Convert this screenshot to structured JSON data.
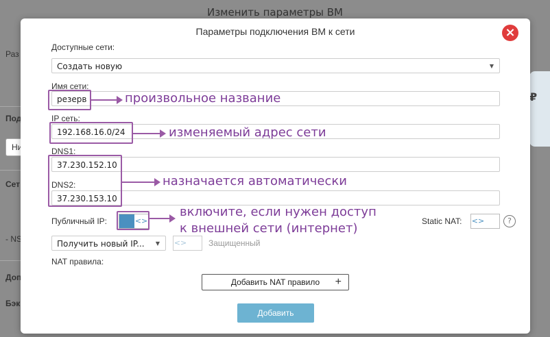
{
  "background": {
    "title": "Изменить параметры ВМ",
    "fragments": [
      "Раз",
      "Под",
      "Ни",
      "Сет",
      "- NS",
      "Доп",
      "Бэк"
    ],
    "currency": "₽"
  },
  "modal": {
    "title": "Параметры подключения ВМ к сети",
    "close_icon": "close-icon",
    "available_networks": {
      "label": "Доступные сети:",
      "value": "Создать новую"
    },
    "network_name": {
      "label": "Имя сети:",
      "value": "резерв"
    },
    "ip_network": {
      "label": "IP сеть:",
      "value": "192.168.16.0/24"
    },
    "dns1": {
      "label": "DNS1:",
      "value": "37.230.152.10"
    },
    "dns2": {
      "label": "DNS2:",
      "value": "37.230.153.10"
    },
    "public_ip": {
      "label": "Публичный IP:",
      "toggle_glyph": "<>"
    },
    "static_nat": {
      "label": "Static NAT:",
      "toggle_glyph": "<>",
      "help": "?"
    },
    "ip_select": {
      "value": "Получить новый IP..."
    },
    "protected": {
      "label": "Защищенный",
      "toggle_glyph": "<>"
    },
    "nat_rules": {
      "label": "NAT правила:"
    },
    "add_nat_button": {
      "label": "Добавить NAT правило",
      "plus": "+"
    },
    "add_button": {
      "label": "Добавить"
    }
  },
  "annotations": {
    "name": "произвольное название",
    "ip": "изменяемый адрес сети",
    "dns": "назначается автоматически",
    "public_line1": "включите, если нужен доступ",
    "public_line2": "к внешней сети (интернет)"
  },
  "colors": {
    "accent": "#9a5aa5",
    "annotation_text": "#7d3c98",
    "close": "#e03c3c",
    "primary_button": "#6db3d2",
    "toggle_on": "#4a90c0"
  }
}
